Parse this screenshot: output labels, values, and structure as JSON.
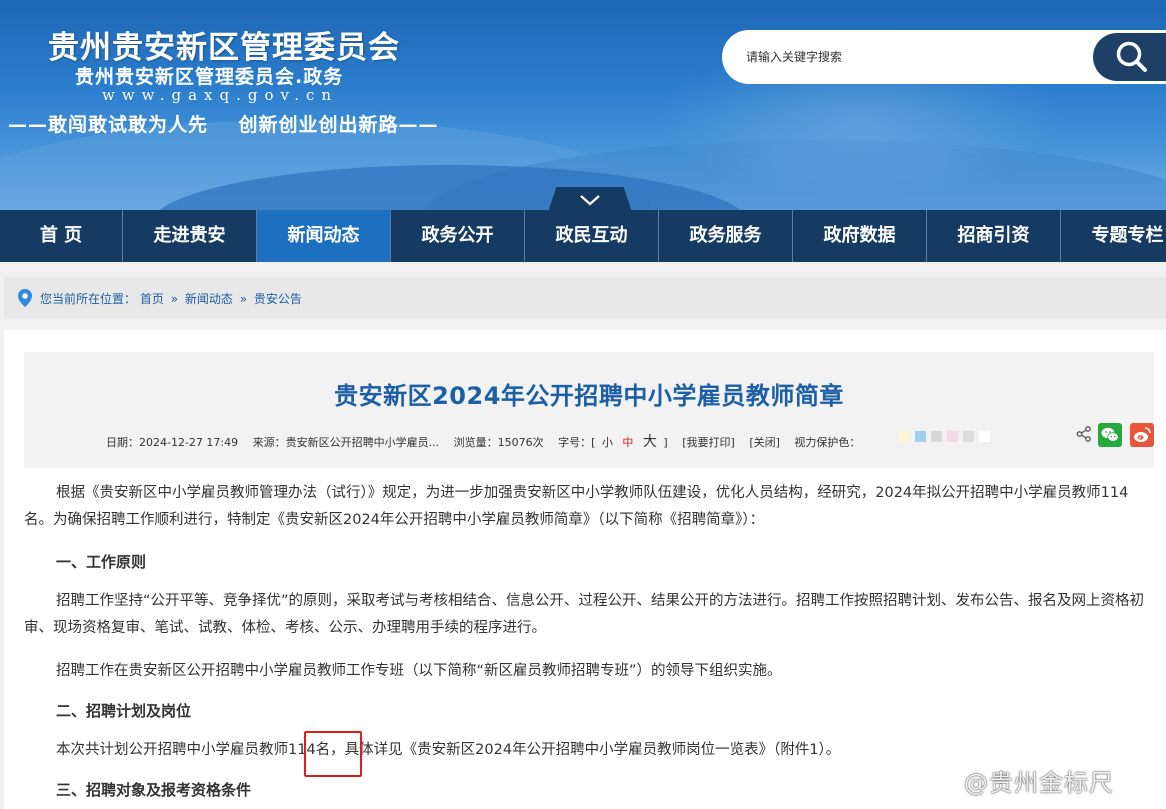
{
  "header": {
    "title": "贵州贵安新区管理委员会",
    "subtitle": "贵州贵安新区管理委员会.政务",
    "url": "www.gaxq.gov.cn",
    "slogan": "——敢闯敢试敢为人先    创新创业创出新路——"
  },
  "search": {
    "placeholder": "请输入关键字搜索"
  },
  "nav": {
    "items": [
      "首 页",
      "走进贵安",
      "新闻动态",
      "政务公开",
      "政民互动",
      "政务服务",
      "政府数据",
      "招商引资",
      "专题专栏"
    ],
    "active": "新闻动态"
  },
  "breadcrumb": {
    "prefix": "您当前所在位置：",
    "items": [
      "首页",
      "新闻动态",
      "贵安公告"
    ],
    "separator": "»"
  },
  "article": {
    "title": "贵安新区2024年公开招聘中小学雇员教师简章",
    "meta": {
      "date": "日期：2024-12-27 17:49",
      "source": "来源：贵安新区公开招聘中小学雇员...",
      "views": "浏览量：15076次",
      "font_size_label": "字号：[",
      "font_small": "小",
      "font_mid": "中",
      "font_big": "大",
      "font_end": "]",
      "print": "[我要打印]",
      "close": "[关闭]",
      "eye_care": "视力保护色："
    },
    "eye_care_colors": [
      "#fbf7d2",
      "#9fd0f2",
      "#d8d8d8",
      "#f4d8e6",
      "#dcdcdc",
      "#ffffff"
    ],
    "paragraphs": {
      "p1": "根据《贵安新区中小学雇员教师管理办法（试行）》规定，为进一步加强贵安新区中小学教师队伍建设，优化人员结构，经研究，2024年拟公开招聘中小学雇员教师114名。为确保招聘工作顺利进行，特制定《贵安新区2024年公开招聘中小学雇员教师简章》（以下简称《招聘简章》）：",
      "h1": "一、工作原则",
      "p2": "招聘工作坚持“公开平等、竞争择优”的原则，采取考试与考核相结合、信息公开、过程公开、结果公开的方法进行。招聘工作按照招聘计划、发布公告、报名及网上资格初审、现场资格复审、笔试、试教、体检、考核、公示、办理聘用手续的程序进行。",
      "p3": "招聘工作在贵安新区公开招聘中小学雇员教师工作专班（以下简称“新区雇员教师招聘专班”）的领导下组织实施。",
      "h2": "二、招聘计划及岗位",
      "p4": "本次共计划公开招聘中小学雇员教师114名，具体详见《贵安新区2024年公开招聘中小学雇员教师岗位一览表》（附件1）。",
      "h3": "三、招聘对象及报考资格条件"
    }
  },
  "watermark": "@贵州金标尺",
  "icons": {
    "search": "search-icon",
    "toggle": "chevron-down-icon",
    "pin": "location-pin-icon",
    "share": "share-icon",
    "wechat": "wechat-icon",
    "weibo": "weibo-icon"
  },
  "colors": {
    "nav_bg": "#163b63",
    "nav_active": "#1d6fc0",
    "title_blue": "#1d5fa6",
    "highlight_red": "#e21b1b"
  }
}
